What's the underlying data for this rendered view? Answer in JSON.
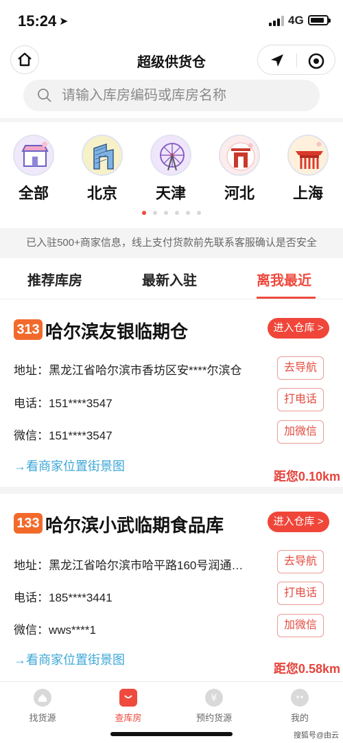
{
  "status": {
    "time": "15:24",
    "network": "4G"
  },
  "nav": {
    "title": "超级供货仓"
  },
  "search": {
    "placeholder": "请输入库房编码或库房名称"
  },
  "categories": [
    {
      "label": "全部",
      "icon": "store-icon"
    },
    {
      "label": "北京",
      "icon": "beijing-landmark-icon"
    },
    {
      "label": "天津",
      "icon": "tianjin-ferris-wheel-icon"
    },
    {
      "label": "河北",
      "icon": "hebei-landmark-icon"
    },
    {
      "label": "上海",
      "icon": "shanghai-pavilion-icon"
    }
  ],
  "carousel": {
    "pages": 6,
    "active": 0
  },
  "notice": "已入驻500+商家信息，线上支付货款前先联系客服确认是否安全",
  "tabs": [
    {
      "label": "推荐库房",
      "active": false
    },
    {
      "label": "最新入驻",
      "active": false
    },
    {
      "label": "离我最近",
      "active": true
    }
  ],
  "warehouses": [
    {
      "code": "313",
      "name": "哈尔滨友银临期仓",
      "enter_label": "进入仓库 >",
      "address": "地址：黑龙江省哈尔滨市香坊区安****尔滨仓",
      "phone": "电话：151****3547",
      "wechat": "微信：151****3547",
      "nav_btn": "去导航",
      "call_btn": "打电话",
      "wechat_btn": "加微信",
      "streetview": "→看商家位置街景图",
      "distance": "距您0.10km"
    },
    {
      "code": "133",
      "name": "哈尔滨小武临期食品库",
      "enter_label": "进入仓库 >",
      "address": "地址：黑龙江省哈尔滨市哈平路160号润通…",
      "phone": "电话：185****3441",
      "wechat": "微信：wws****1",
      "nav_btn": "去导航",
      "call_btn": "打电话",
      "wechat_btn": "加微信",
      "streetview": "→看商家位置街景图",
      "distance": "距您0.58km"
    }
  ],
  "tabbar": [
    {
      "label": "找货源",
      "icon": "home-icon",
      "active": false
    },
    {
      "label": "查库房",
      "icon": "shopping-bag-icon",
      "active": true
    },
    {
      "label": "预约货源",
      "icon": "yen-icon",
      "active": false
    },
    {
      "label": "我的",
      "icon": "profile-icon",
      "active": false
    }
  ],
  "watermark": "搜狐号@由云",
  "colors": {
    "accent": "#ef4a3e",
    "badge": "#f26a2b",
    "link": "#3ea7d6"
  }
}
